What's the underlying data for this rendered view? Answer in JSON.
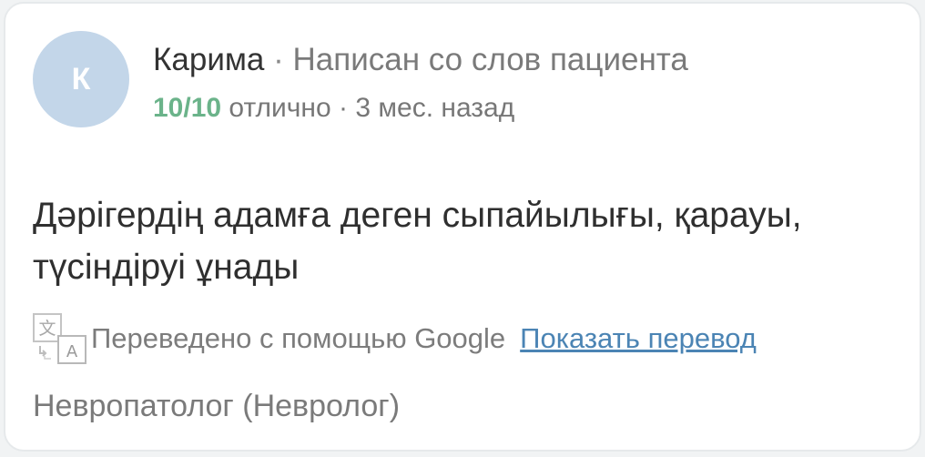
{
  "review": {
    "avatar_letter": "К",
    "author_name": "Карима",
    "separator": "·",
    "source": "Написан со слов пациента",
    "score": "10/10",
    "rating_word": "отлично",
    "date": "3 мес. назад",
    "text": "Дәрігердің адамға деген сыпайылығы, қарауы, түсіндіруі ұнады",
    "translation": {
      "icon": "google-translate-icon",
      "note": "Переведено с помощью Google",
      "show_link": "Показать перевод"
    },
    "specialty": "Невропатолог (Невролог)"
  },
  "colors": {
    "avatar_bg": "#c3d6e9",
    "score": "#6bb38a",
    "link": "#4b84b4",
    "muted_text": "#7a7a7a",
    "main_text": "#2f2f2f"
  }
}
